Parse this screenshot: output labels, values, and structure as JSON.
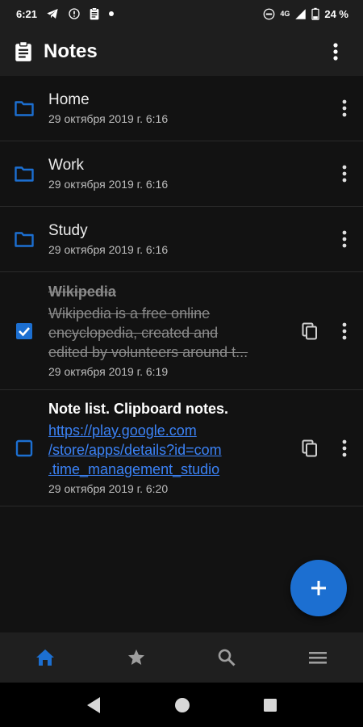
{
  "status_bar": {
    "time": "6:21",
    "network": "4G",
    "battery": "24 %",
    "icons": [
      "telegram-icon",
      "sync-icon",
      "clipboard-icon",
      "dot-icon",
      "dnd-icon",
      "signal-icon",
      "battery-icon"
    ]
  },
  "app_bar": {
    "title": "Notes",
    "icons": [
      "clipboard-icon",
      "more-vert-icon"
    ]
  },
  "folders": [
    {
      "name": "Home",
      "date": "29 октября 2019 г. 6:16"
    },
    {
      "name": "Work",
      "date": "29 октября 2019 г. 6:16"
    },
    {
      "name": "Study",
      "date": "29 октября 2019 г. 6:16"
    }
  ],
  "notes": [
    {
      "title": "Wikipedia",
      "lines": [
        "Wikipedia is a free online",
        "encyclopedia, created and",
        "edited by volunteers around t..."
      ],
      "date": "29 октября 2019 г. 6:19",
      "checked": true
    },
    {
      "title": "Note list. Clipboard notes.",
      "link_lines": [
        "https://play.google.com",
        "/store/apps/details?id=com",
        ".time_management_studio"
      ],
      "date": "29 октября 2019 г. 6:20",
      "checked": false
    }
  ],
  "fab": {
    "icon": "plus-icon"
  },
  "bottom_nav": [
    {
      "icon": "home-icon",
      "active": true
    },
    {
      "icon": "star-icon",
      "active": false
    },
    {
      "icon": "search-icon",
      "active": false
    },
    {
      "icon": "menu-icon",
      "active": false
    }
  ],
  "system_nav": [
    "back-icon",
    "home-circle-icon",
    "recents-icon"
  ],
  "colors": {
    "accent": "#1c6fd1",
    "link": "#3b82f6",
    "background": "#121212",
    "bar": "#1e1e1e"
  }
}
